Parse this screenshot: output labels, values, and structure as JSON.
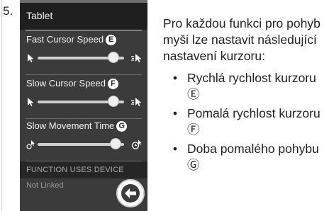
{
  "step_number": "5.",
  "panel": {
    "title": "Tablet",
    "settings": [
      {
        "label": "Fast Cursor Speed",
        "badge": "E",
        "value": 0.88,
        "low_icon": "slow-cursor-icon",
        "high_icon": "fast-cursor-icon"
      },
      {
        "label": "Slow Cursor Speed",
        "badge": "F",
        "value": 0.88,
        "low_icon": "slow-cursor-icon",
        "high_icon": "fast-cursor-icon"
      },
      {
        "label": "Slow Movement Time",
        "badge": "G",
        "value": 0.9,
        "low_icon": "short-time-icon",
        "high_icon": "long-time-icon"
      }
    ],
    "section_header": "FUNCTION USES DEVICE",
    "device_status": "Not Linked",
    "back_icon": "back-arrow-icon"
  },
  "description": {
    "intro": "Pro každou funkci pro pohyb myši lze nastavit následující nastavení kurzoru:",
    "bullet_char": "•",
    "items": [
      {
        "text": "Rychlá rychlost kurzoru",
        "marker": "Ⓔ"
      },
      {
        "text": "Pomalá rychlost kurzoru",
        "marker": "Ⓕ"
      },
      {
        "text": "Doba pomalého pohybu",
        "marker": "Ⓖ"
      }
    ]
  },
  "colors": {
    "panel_bg": "#3b3b3b",
    "header_bg": "#1f1f1f",
    "text_light": "#f4f4f4",
    "accent_white": "#ffffff"
  }
}
